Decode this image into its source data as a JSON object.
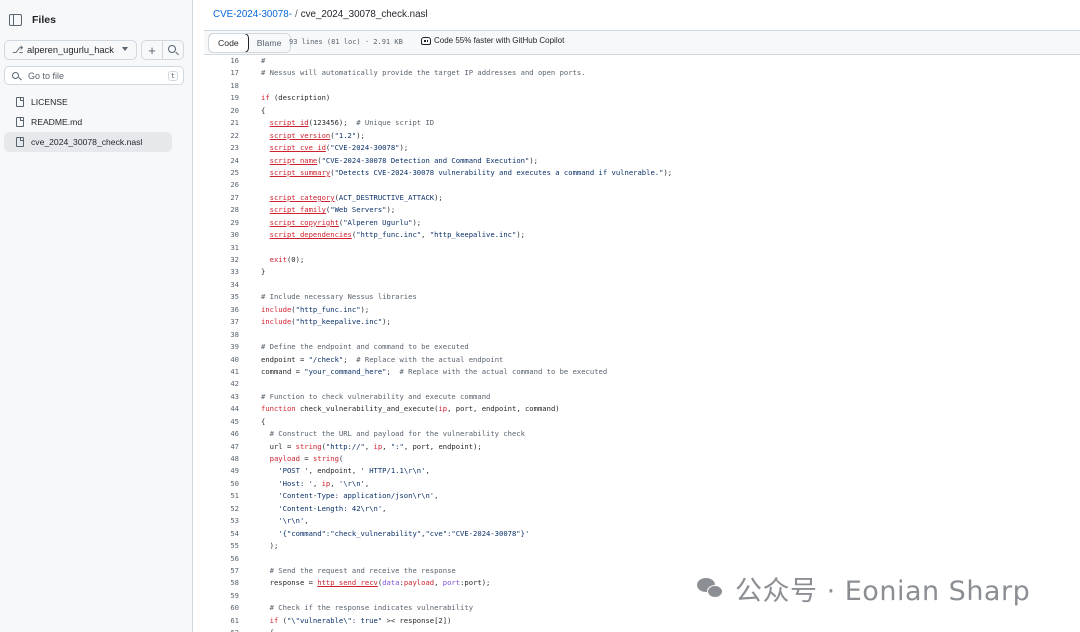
{
  "sidebar": {
    "title": "Files",
    "branch": "alperen_ugurlu_hack",
    "search": {
      "placeholder": "Go to file",
      "shortcut": "t"
    },
    "files": [
      {
        "name": "LICENSE",
        "active": false
      },
      {
        "name": "README.md",
        "active": false
      },
      {
        "name": "cve_2024_30078_check.nasl",
        "active": true
      }
    ]
  },
  "header": {
    "breadcrumb_repo": "CVE-2024-30078-",
    "breadcrumb_sep": "/",
    "breadcrumb_file": "cve_2024_30078_check.nasl"
  },
  "toolbar": {
    "tabs": [
      {
        "label": "Code",
        "active": true
      },
      {
        "label": "Blame",
        "active": false
      }
    ],
    "meta": "93 lines (81 loc) · 2.91 KB",
    "copilot": "Code 55% faster with GitHub Copilot"
  },
  "code": {
    "lines": [
      {
        "n": "16",
        "tokens": [
          {
            "t": "#",
            "c": "com"
          }
        ]
      },
      {
        "n": "17",
        "tokens": [
          {
            "t": "# Nessus will automatically provide the target IP addresses and open ports.",
            "c": "com"
          }
        ]
      },
      {
        "n": "18",
        "tokens": []
      },
      {
        "n": "19",
        "tokens": [
          {
            "t": "if",
            "c": "kw"
          },
          {
            "t": " (description)"
          }
        ]
      },
      {
        "n": "20",
        "tokens": [
          {
            "t": "{"
          }
        ]
      },
      {
        "n": "21",
        "tokens": [
          {
            "t": "  "
          },
          {
            "t": "script_id",
            "c": "fn"
          },
          {
            "t": "(123456);  "
          },
          {
            "t": "# Unique script ID",
            "c": "com"
          }
        ]
      },
      {
        "n": "22",
        "tokens": [
          {
            "t": "  "
          },
          {
            "t": "script_version",
            "c": "fn"
          },
          {
            "t": "("
          },
          {
            "t": "\"1.2\"",
            "c": "str"
          },
          {
            "t": ");"
          }
        ]
      },
      {
        "n": "23",
        "tokens": [
          {
            "t": "  "
          },
          {
            "t": "script_cve_id",
            "c": "fn"
          },
          {
            "t": "("
          },
          {
            "t": "\"CVE-2024-30078\"",
            "c": "str"
          },
          {
            "t": ");"
          }
        ]
      },
      {
        "n": "24",
        "tokens": [
          {
            "t": "  "
          },
          {
            "t": "script_name",
            "c": "fn"
          },
          {
            "t": "("
          },
          {
            "t": "\"CVE-2024-30078 Detection and Command Execution\"",
            "c": "str"
          },
          {
            "t": ");"
          }
        ]
      },
      {
        "n": "25",
        "tokens": [
          {
            "t": "  "
          },
          {
            "t": "script_summary",
            "c": "fn"
          },
          {
            "t": "("
          },
          {
            "t": "\"Detects CVE-2024-30078 vulnerability and executes a command if vulnerable.\"",
            "c": "str"
          },
          {
            "t": ");"
          }
        ]
      },
      {
        "n": "26",
        "tokens": []
      },
      {
        "n": "27",
        "tokens": [
          {
            "t": "  "
          },
          {
            "t": "script_category",
            "c": "fn"
          },
          {
            "t": "("
          },
          {
            "t": "ACT_DESTRUCTIVE_ATTACK",
            "c": "str"
          },
          {
            "t": ");"
          }
        ]
      },
      {
        "n": "28",
        "tokens": [
          {
            "t": "  "
          },
          {
            "t": "script_family",
            "c": "fn"
          },
          {
            "t": "("
          },
          {
            "t": "\"Web Servers\"",
            "c": "str"
          },
          {
            "t": ");"
          }
        ]
      },
      {
        "n": "29",
        "tokens": [
          {
            "t": "  "
          },
          {
            "t": "script_copyright",
            "c": "fn"
          },
          {
            "t": "("
          },
          {
            "t": "\"Alperen Ugurlu\"",
            "c": "str"
          },
          {
            "t": ");"
          }
        ]
      },
      {
        "n": "30",
        "tokens": [
          {
            "t": "  "
          },
          {
            "t": "script_dependencies",
            "c": "fn"
          },
          {
            "t": "("
          },
          {
            "t": "\"http_func.inc\"",
            "c": "str"
          },
          {
            "t": ", "
          },
          {
            "t": "\"http_keepalive.inc\"",
            "c": "str"
          },
          {
            "t": ");"
          }
        ]
      },
      {
        "n": "31",
        "tokens": []
      },
      {
        "n": "32",
        "tokens": [
          {
            "t": "  "
          },
          {
            "t": "exit",
            "c": "kw"
          },
          {
            "t": "(0);"
          }
        ]
      },
      {
        "n": "33",
        "tokens": [
          {
            "t": "}"
          }
        ]
      },
      {
        "n": "34",
        "tokens": []
      },
      {
        "n": "35",
        "tokens": [
          {
            "t": "# Include necessary Nessus libraries",
            "c": "com"
          }
        ]
      },
      {
        "n": "36",
        "tokens": [
          {
            "t": "include",
            "c": "kw"
          },
          {
            "t": "("
          },
          {
            "t": "\"http_func.inc\"",
            "c": "str"
          },
          {
            "t": ");"
          }
        ]
      },
      {
        "n": "37",
        "tokens": [
          {
            "t": "include",
            "c": "kw"
          },
          {
            "t": "("
          },
          {
            "t": "\"http_keepalive.inc\"",
            "c": "str"
          },
          {
            "t": ");"
          }
        ]
      },
      {
        "n": "38",
        "tokens": []
      },
      {
        "n": "39",
        "tokens": [
          {
            "t": "# Define the endpoint and command to be executed",
            "c": "com"
          }
        ]
      },
      {
        "n": "40",
        "tokens": [
          {
            "t": "endpoint = "
          },
          {
            "t": "\"/check\"",
            "c": "str"
          },
          {
            "t": ";  "
          },
          {
            "t": "# Replace with the actual endpoint",
            "c": "com"
          }
        ]
      },
      {
        "n": "41",
        "tokens": [
          {
            "t": "command = "
          },
          {
            "t": "\"your_command_here\"",
            "c": "str"
          },
          {
            "t": ";  "
          },
          {
            "t": "# Replace with the actual command to be executed",
            "c": "com"
          }
        ]
      },
      {
        "n": "42",
        "tokens": []
      },
      {
        "n": "43",
        "tokens": [
          {
            "t": "# Function to check vulnerability and execute command",
            "c": "com"
          }
        ]
      },
      {
        "n": "44",
        "tokens": [
          {
            "t": "function",
            "c": "kw"
          },
          {
            "t": " check_vulnerability_and_execute("
          },
          {
            "t": "ip",
            "c": "kw"
          },
          {
            "t": ", port, endpoint, command)"
          }
        ]
      },
      {
        "n": "45",
        "tokens": [
          {
            "t": "{"
          }
        ]
      },
      {
        "n": "46",
        "tokens": [
          {
            "t": "  "
          },
          {
            "t": "# Construct the URL and payload for the vulnerability check",
            "c": "com"
          }
        ]
      },
      {
        "n": "47",
        "tokens": [
          {
            "t": "  url = "
          },
          {
            "t": "string",
            "c": "kw"
          },
          {
            "t": "("
          },
          {
            "t": "\"http://\"",
            "c": "str"
          },
          {
            "t": ", "
          },
          {
            "t": "ip",
            "c": "kw"
          },
          {
            "t": ", "
          },
          {
            "t": "\":\"",
            "c": "str"
          },
          {
            "t": ", port, endpoint);"
          }
        ]
      },
      {
        "n": "48",
        "tokens": [
          {
            "t": "  "
          },
          {
            "t": "payload",
            "c": "kw"
          },
          {
            "t": " = "
          },
          {
            "t": "string",
            "c": "kw"
          },
          {
            "t": "("
          }
        ]
      },
      {
        "n": "49",
        "tokens": [
          {
            "t": "    "
          },
          {
            "t": "'POST '",
            "c": "str"
          },
          {
            "t": ", endpoint, "
          },
          {
            "t": "' HTTP/1.1\\r\\n'",
            "c": "str"
          },
          {
            "t": ","
          }
        ]
      },
      {
        "n": "50",
        "tokens": [
          {
            "t": "    "
          },
          {
            "t": "'Host: '",
            "c": "str"
          },
          {
            "t": ", "
          },
          {
            "t": "ip",
            "c": "kw"
          },
          {
            "t": ", "
          },
          {
            "t": "'\\r\\n'",
            "c": "str"
          },
          {
            "t": ","
          }
        ]
      },
      {
        "n": "51",
        "tokens": [
          {
            "t": "    "
          },
          {
            "t": "'Content-Type: application/json\\r\\n'",
            "c": "str"
          },
          {
            "t": ","
          }
        ]
      },
      {
        "n": "52",
        "tokens": [
          {
            "t": "    "
          },
          {
            "t": "'Content-Length: 42\\r\\n'",
            "c": "str"
          },
          {
            "t": ","
          }
        ]
      },
      {
        "n": "53",
        "tokens": [
          {
            "t": "    "
          },
          {
            "t": "'\\r\\n'",
            "c": "str"
          },
          {
            "t": ","
          }
        ]
      },
      {
        "n": "54",
        "tokens": [
          {
            "t": "    "
          },
          {
            "t": "'{\"command\":\"check_vulnerability\",\"cve\":\"CVE-2024-30078\"}'",
            "c": "str"
          }
        ]
      },
      {
        "n": "55",
        "tokens": [
          {
            "t": "  );"
          }
        ]
      },
      {
        "n": "56",
        "tokens": []
      },
      {
        "n": "57",
        "tokens": [
          {
            "t": "  "
          },
          {
            "t": "# Send the request and receive the response",
            "c": "com"
          }
        ]
      },
      {
        "n": "58",
        "tokens": [
          {
            "t": "  response = "
          },
          {
            "t": "http_send_recv",
            "c": "fn"
          },
          {
            "t": "("
          },
          {
            "t": "data",
            "c": "ent"
          },
          {
            "t": ":"
          },
          {
            "t": "payload",
            "c": "kw"
          },
          {
            "t": ", "
          },
          {
            "t": "port",
            "c": "ent"
          },
          {
            "t": ":port);"
          }
        ]
      },
      {
        "n": "59",
        "tokens": []
      },
      {
        "n": "60",
        "tokens": [
          {
            "t": "  "
          },
          {
            "t": "# Check if the response indicates vulnerability",
            "c": "com"
          }
        ]
      },
      {
        "n": "61",
        "tokens": [
          {
            "t": "  "
          },
          {
            "t": "if",
            "c": "kw"
          },
          {
            "t": " ("
          },
          {
            "t": "\"\\\"vulnerable\\\": true\"",
            "c": "str"
          },
          {
            "t": " >< response[2])"
          }
        ]
      },
      {
        "n": "62",
        "tokens": [
          {
            "t": "  {"
          }
        ]
      }
    ]
  },
  "watermark": {
    "text": "公众号 · Eonian Sharp"
  },
  "colors": {
    "link": "#0969da",
    "keyword": "#cf222e",
    "string": "#0a3069",
    "comment": "#59636e",
    "sidebar_bg": "#f6f8fa"
  }
}
